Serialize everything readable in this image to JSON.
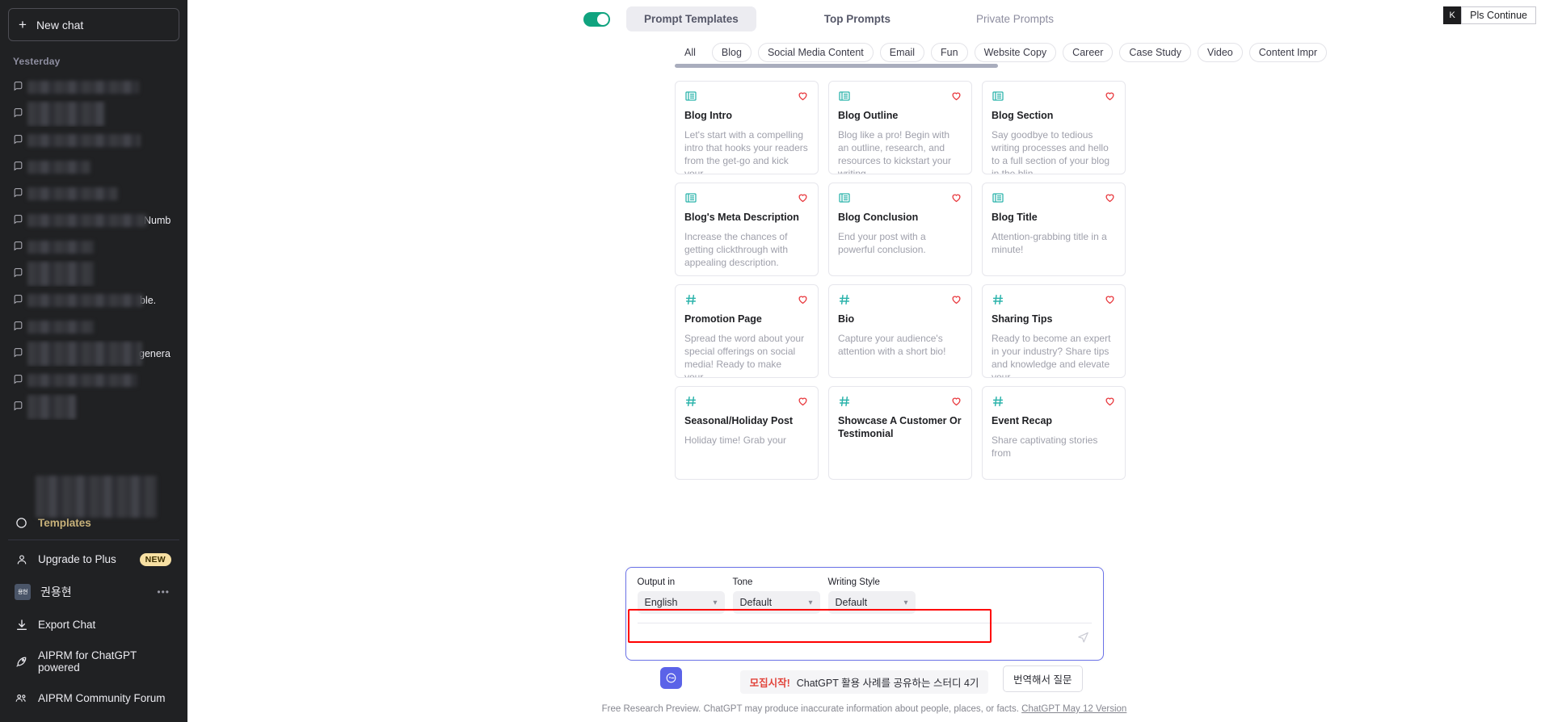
{
  "sidebar": {
    "new_chat_label": "New chat",
    "history_group_label": "Yesterday",
    "history_items": [
      {
        "visible_fragment": "",
        "redact_width": 138,
        "redact_lines": 1
      },
      {
        "visible_fragment": "",
        "redact_width": 96,
        "redact_lines": 2
      },
      {
        "visible_fragment": "",
        "redact_width": 140,
        "redact_lines": 1
      },
      {
        "visible_fragment": "",
        "redact_width": 78,
        "redact_lines": 1
      },
      {
        "visible_fragment": "",
        "redact_width": 112,
        "redact_lines": 1
      },
      {
        "visible_fragment": "Numb",
        "redact_width": 148,
        "redact_lines": 1
      },
      {
        "visible_fragment": "",
        "redact_width": 82,
        "redact_lines": 1
      },
      {
        "visible_fragment": "",
        "redact_width": 82,
        "redact_lines": 2
      },
      {
        "visible_fragment": "ble.",
        "redact_width": 143,
        "redact_lines": 1
      },
      {
        "visible_fragment": "",
        "redact_width": 82,
        "redact_lines": 1
      },
      {
        "visible_fragment": "genera",
        "redact_width": 142,
        "redact_lines": 2
      },
      {
        "visible_fragment": "",
        "redact_width": 136,
        "redact_lines": 1
      },
      {
        "visible_fragment": "",
        "redact_width": 60,
        "redact_lines": 2
      }
    ],
    "templates_label": "Templates",
    "bottom_items": [
      {
        "icon": "person-icon",
        "label": "Upgrade to Plus",
        "badge": "NEW"
      },
      {
        "icon": "user-avatar",
        "label": "권용현",
        "avatar_text": "용현",
        "menu": "•••"
      },
      {
        "icon": "download-icon",
        "label": "Export Chat"
      },
      {
        "icon": "rocket-icon",
        "label": "AIPRM for ChatGPT powered"
      },
      {
        "icon": "community-icon",
        "label": "AIPRM Community Forum"
      }
    ]
  },
  "extension_button": {
    "avatar_letter": "K",
    "label": "Pls Continue"
  },
  "aiprm": {
    "toggle_on": true,
    "tabs": [
      {
        "label": "Prompt Templates",
        "active": true
      },
      {
        "label": "Top Prompts",
        "active": false
      },
      {
        "label": "Private Prompts",
        "active": false,
        "muted": true
      }
    ],
    "categories": [
      {
        "label": "All",
        "active": true
      },
      {
        "label": "Blog",
        "active": false
      },
      {
        "label": "Social Media Content",
        "active": false
      },
      {
        "label": "Email",
        "active": false
      },
      {
        "label": "Fun",
        "active": false
      },
      {
        "label": "Website Copy",
        "active": false
      },
      {
        "label": "Career",
        "active": false
      },
      {
        "label": "Case Study",
        "active": false
      },
      {
        "label": "Video",
        "active": false
      },
      {
        "label": "Content Impr",
        "active": false
      }
    ],
    "cards": [
      {
        "icon": "newspaper-icon",
        "title": "Blog Intro",
        "desc": "Let's start with a compelling intro that hooks your readers from the get-go and kick your…",
        "favorite_icon": "heart-icon"
      },
      {
        "icon": "newspaper-icon",
        "title": "Blog Outline",
        "desc": "Blog like a pro! Begin with an outline, research, and resources to kickstart your writing…",
        "favorite_icon": "heart-icon"
      },
      {
        "icon": "newspaper-icon",
        "title": "Blog Section",
        "desc": "Say goodbye to tedious writing processes and hello to a full section of your blog in the blin…",
        "favorite_icon": "heart-icon"
      },
      {
        "icon": "newspaper-icon",
        "title": "Blog's Meta Description",
        "desc": "Increase the chances of getting clickthrough with appealing description.",
        "favorite_icon": "heart-icon"
      },
      {
        "icon": "newspaper-icon",
        "title": "Blog Conclusion",
        "desc": "End your post with a powerful conclusion.",
        "favorite_icon": "heart-icon"
      },
      {
        "icon": "newspaper-icon",
        "title": "Blog Title",
        "desc": "Attention-grabbing title in a minute!",
        "favorite_icon": "heart-icon"
      },
      {
        "icon": "hashtag-icon",
        "title": "Promotion Page",
        "desc": "Spread the word about your special offerings on social media! Ready to make your…",
        "favorite_icon": "heart-icon"
      },
      {
        "icon": "hashtag-icon",
        "title": "Bio",
        "desc": "Capture your audience's attention with a short bio!",
        "favorite_icon": "heart-icon"
      },
      {
        "icon": "hashtag-icon",
        "title": "Sharing Tips",
        "desc": "Ready to become an expert in your industry? Share tips and knowledge and elevate your…",
        "favorite_icon": "heart-icon"
      },
      {
        "icon": "hashtag-icon",
        "title": "Seasonal/Holiday Post",
        "desc": "Holiday time! Grab your",
        "favorite_icon": "heart-icon"
      },
      {
        "icon": "hashtag-icon",
        "title": "Showcase A Customer Or Testimonial",
        "desc": "",
        "favorite_icon": "heart-icon"
      },
      {
        "icon": "hashtag-icon",
        "title": "Event Recap",
        "desc": "Share captivating stories from",
        "favorite_icon": "heart-icon"
      }
    ]
  },
  "composer": {
    "selects": [
      {
        "label": "Output in",
        "value": "English"
      },
      {
        "label": "Tone",
        "value": "Default"
      },
      {
        "label": "Writing Style",
        "value": "Default"
      }
    ],
    "input_value": "",
    "input_placeholder": "",
    "send_icon": "send-icon"
  },
  "bottom_bar": {
    "aiprm_button_icon": "aiprm-logo-icon",
    "promo_highlight": "모집시작!",
    "promo_text": "ChatGPT 활용 사례를 공유하는 스터디 4기",
    "translate_label": "번역해서 질문",
    "footnote_text": "Free Research Preview. ChatGPT may produce inaccurate information about people, places, or facts.",
    "footnote_link": "ChatGPT May 12 Version"
  },
  "colors": {
    "sidebar_bg": "#202123",
    "accent_teal": "#2bb3ab",
    "toggle_green": "#10a37f",
    "heart_red": "#e8353a",
    "highlight_red": "#ff0000",
    "composer_border": "#6b72e8",
    "aiprm_blue": "#5b63e8",
    "badge_yellow": "#f7e0a3"
  }
}
